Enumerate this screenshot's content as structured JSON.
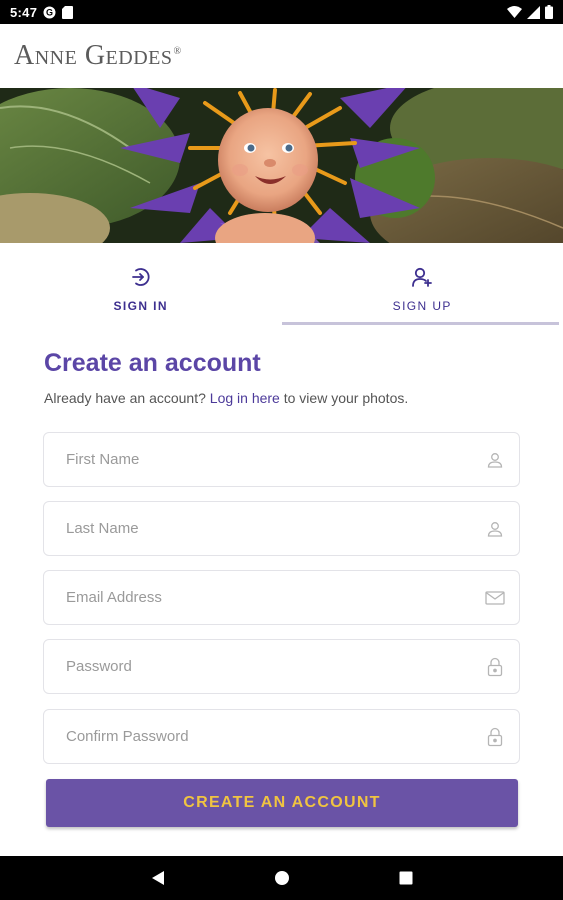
{
  "status_bar": {
    "time": "5:47",
    "icons": [
      "google-icon",
      "sdcard-icon",
      "wifi-icon",
      "signal-icon",
      "battery-icon"
    ]
  },
  "header": {
    "brand": "Anne Geddes",
    "registered_mark": "®"
  },
  "hero": {
    "image": "baby-flower-photo"
  },
  "tabs": [
    {
      "label": "SIGN IN",
      "icon": "sign-in-icon",
      "active": false
    },
    {
      "label": "SIGN UP",
      "icon": "add-user-icon",
      "active": true
    }
  ],
  "form": {
    "title": "Create an account",
    "subtitle_pre": "Already have an account?",
    "subtitle_link": "Log in here",
    "subtitle_post": "to view your photos.",
    "fields": [
      {
        "placeholder": "First Name",
        "icon": "user-icon",
        "value": ""
      },
      {
        "placeholder": "Last Name",
        "icon": "user-icon",
        "value": ""
      },
      {
        "placeholder": "Email Address",
        "icon": "envelope-icon",
        "value": ""
      },
      {
        "placeholder": "Password",
        "icon": "lock-icon",
        "value": ""
      },
      {
        "placeholder": "Confirm Password",
        "icon": "lock-icon",
        "value": ""
      }
    ],
    "submit_label": "CREATE AN ACCOUNT"
  },
  "colors": {
    "accent": "#5b46a6",
    "button_bg": "#6a53a6",
    "button_text": "#f0c441",
    "tab_text": "#3d2f8f"
  },
  "nav_bar": {
    "buttons": [
      "back-icon",
      "home-icon",
      "recents-icon"
    ]
  }
}
